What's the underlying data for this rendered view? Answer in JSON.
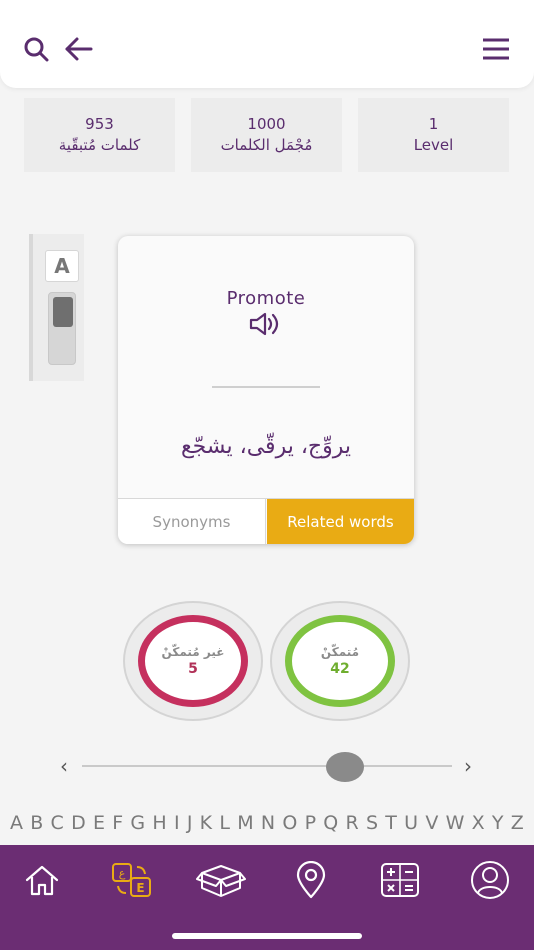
{
  "stats": {
    "remaining": {
      "value": "953",
      "label": "كلمات مُتبقّية"
    },
    "total": {
      "value": "1000",
      "label": "مُجْمَل الكلمات"
    },
    "level": {
      "value": "1",
      "label": "Level"
    }
  },
  "font_toggle": {
    "label": "A"
  },
  "card": {
    "word": "Promote",
    "meaning": "يروِّج، يرقّى، يشجّع",
    "tabs": {
      "synonyms": "Synonyms",
      "related": "Related words"
    }
  },
  "progress": {
    "not_mastered": {
      "label": "غير مُتمكّنْ",
      "count": "5",
      "color": "#c5305e"
    },
    "mastered": {
      "label": "مُتمكّنْ",
      "count": "42",
      "color": "#7fc341"
    }
  },
  "slider": {
    "prev": "‹",
    "next": "›",
    "position": 0.71
  },
  "alphabet": [
    "A",
    "B",
    "C",
    "D",
    "E",
    "F",
    "G",
    "H",
    "I",
    "J",
    "K",
    "L",
    "M",
    "N",
    "O",
    "P",
    "Q",
    "R",
    "S",
    "T",
    "U",
    "V",
    "W",
    "X",
    "Y",
    "Z"
  ],
  "icons": {
    "top_left": [
      "search-icon",
      "back-arrow-icon"
    ],
    "top_right": "menu-icon",
    "nav": [
      "home-icon",
      "translate-icon",
      "box-icon",
      "location-icon",
      "calculator-icon",
      "profile-icon"
    ]
  },
  "colors": {
    "primary": "#5a2d6e",
    "nav_background": "#6b2d73",
    "accent": "#e9ab14",
    "nav_active": "#e9ab14"
  }
}
